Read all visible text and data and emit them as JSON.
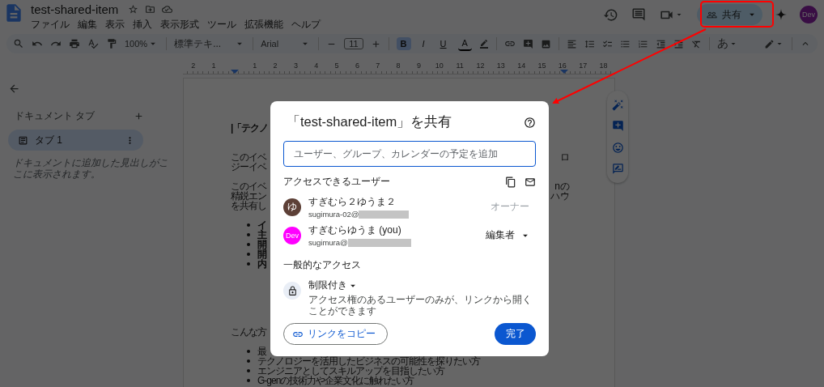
{
  "document_title": "test-shared-item",
  "menu": [
    "ファイル",
    "編集",
    "表示",
    "挿入",
    "表示形式",
    "ツール",
    "拡張機能",
    "ヘルプ"
  ],
  "toolbar": {
    "zoom": "100%",
    "style": "標準テキ...",
    "font": "Arial",
    "font_size": "11",
    "input_tools": "あ",
    "format_buttons": [
      {
        "kind": "bold",
        "label": "B",
        "active": true
      },
      {
        "kind": "italic",
        "label": "I",
        "active": false
      },
      {
        "kind": "underline",
        "label": "U",
        "active": false
      },
      {
        "kind": "text_color",
        "label": "A",
        "active": false
      }
    ]
  },
  "ruler": [
    "2",
    "1",
    "1",
    "2",
    "3",
    "4",
    "5",
    "6",
    "7",
    "8",
    "9",
    "10",
    "11",
    "12",
    "13",
    "14",
    "15",
    "16",
    "17",
    "18"
  ],
  "share_button": {
    "label": "共有"
  },
  "account_avatar": "Dev",
  "sidebar": {
    "heading": "ドキュメント タブ",
    "tabs": [
      {
        "label": "タブ 1",
        "selected": true
      }
    ],
    "hint": "ドキュメントに追加した見出しがここに表示されます。"
  },
  "document": {
    "lines": [
      {
        "kind": "heading",
        "left": "|「テクノ"
      },
      {
        "kind": "blank"
      },
      {
        "kind": "blank"
      },
      {
        "kind": "text",
        "left": "このイベ",
        "right": "ロ"
      },
      {
        "kind": "text",
        "left": "ジーイベ"
      },
      {
        "kind": "blank"
      },
      {
        "kind": "text",
        "left": "このイベ",
        "right": "nの"
      },
      {
        "kind": "text",
        "left": "精鋭エン",
        "right": "ハウ"
      },
      {
        "kind": "text",
        "left": "を共有し"
      },
      {
        "kind": "blank"
      },
      {
        "kind": "bullet",
        "left": "イ",
        "bold": true
      },
      {
        "kind": "bullet",
        "left": "主",
        "bold": true
      },
      {
        "kind": "bullet",
        "left": "開",
        "bold": true
      },
      {
        "kind": "bullet",
        "left": "開",
        "bold": true
      },
      {
        "kind": "bullet",
        "left": "内",
        "bold": true
      },
      {
        "kind": "blank"
      },
      {
        "kind": "blank"
      },
      {
        "kind": "blank"
      },
      {
        "kind": "blank"
      },
      {
        "kind": "blank"
      },
      {
        "kind": "blank"
      },
      {
        "kind": "text",
        "left": "こんな方"
      },
      {
        "kind": "blank"
      },
      {
        "kind": "bullet",
        "left": "最",
        "bold": false
      },
      {
        "kind": "bullet",
        "left": "テクノロジーを活用したビジネスの可能性を探りたい方",
        "bold": false
      },
      {
        "kind": "bullet",
        "left": "エンジニアとしてスキルアップを目指したい方",
        "bold": false
      },
      {
        "kind": "bullet",
        "left": "G-genの技術力や企業文化に触れたい方",
        "bold": false
      }
    ]
  },
  "share_dialog": {
    "title": "「test-shared-item」を共有",
    "add_field": {
      "placeholder": "ユーザー、グループ、カレンダーの予定を追加"
    },
    "people_heading": "アクセスできるユーザー",
    "people": [
      {
        "avatar": "ゆ",
        "color": "#5d4037",
        "name": "すぎむら２ゆうま２",
        "email": "sugimura-02@",
        "role": "オーナー",
        "editable": false
      },
      {
        "avatar": "Dev",
        "color": "#ff00ff",
        "name": "すぎむらゆうま (you)",
        "email": "sugimura@",
        "role": "編集者",
        "editable": true
      }
    ],
    "general_heading": "一般的なアクセス",
    "access": {
      "level": "制限付き",
      "description": "アクセス権のあるユーザーのみが、リンクから開くことができます"
    },
    "copy_link": "リンクをコピー",
    "done": "完了"
  }
}
